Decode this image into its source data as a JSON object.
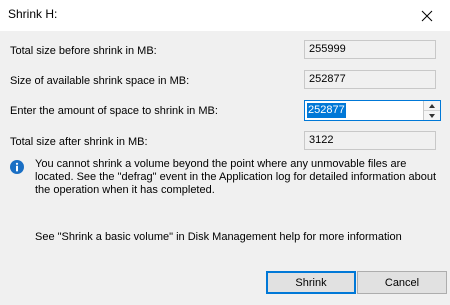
{
  "window": {
    "title": "Shrink H:",
    "close_icon": "close-icon"
  },
  "fields": {
    "total_before_label": "Total size before shrink in MB:",
    "total_before_value": "255999",
    "available_label": "Size of available shrink space in MB:",
    "available_value": "252877",
    "amount_label": "Enter the amount of space to shrink in MB:",
    "amount_value": "252877",
    "total_after_label": "Total size after shrink in MB:",
    "total_after_value": "3122"
  },
  "info": {
    "icon": "info-icon",
    "icon_color": "#1a6fc4",
    "message": "You cannot shrink a volume beyond the point where any unmovable files are located. See the \"defrag\" event in the Application log for detailed information about the operation when it has completed.",
    "help": "See \"Shrink a basic volume\" in Disk Management help for more information"
  },
  "buttons": {
    "shrink_label": "Shrink",
    "cancel_label": "Cancel"
  },
  "colors": {
    "accent": "#0078d7",
    "dialog_bg": "#f0f0f0"
  }
}
